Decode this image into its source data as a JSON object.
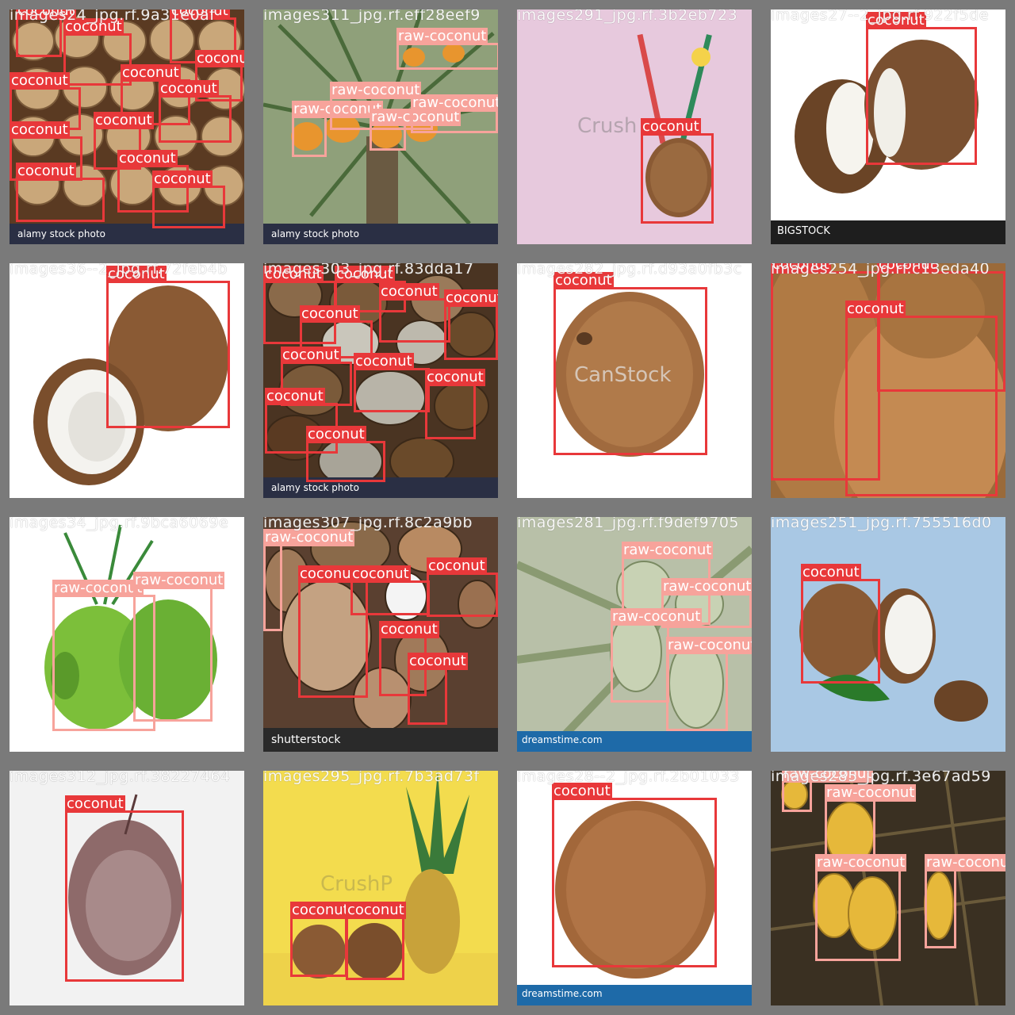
{
  "colors": {
    "coconut": "#e8383a",
    "raw_coconut": "#f7a39b",
    "background": "#7a7a7a"
  },
  "tiles": [
    {
      "title": "images24_jpg.rf.9a31e0af",
      "watermark": "alamy stock photo",
      "boxes": [
        {
          "label": "coconut",
          "cls": "coconut"
        },
        {
          "label": "coconut",
          "cls": "coconut"
        },
        {
          "label": "coconut",
          "cls": "coconut"
        },
        {
          "label": "coconut",
          "cls": "coconut"
        },
        {
          "label": "coconut",
          "cls": "coconut"
        },
        {
          "label": "coconut",
          "cls": "coconut"
        },
        {
          "label": "coconut",
          "cls": "coconut"
        },
        {
          "label": "coconut",
          "cls": "coconut"
        },
        {
          "label": "coconut",
          "cls": "coconut"
        },
        {
          "label": "coconut",
          "cls": "coconut"
        },
        {
          "label": "coconut",
          "cls": "coconut"
        },
        {
          "label": "coconut",
          "cls": "coconut"
        }
      ]
    },
    {
      "title": "images311_jpg.rf.eff28eef9",
      "watermark": "alamy stock photo",
      "boxes": [
        {
          "label": "raw-coconut",
          "cls": "raw"
        },
        {
          "label": "raw-coconut",
          "cls": "raw"
        },
        {
          "label": "raw-coconut",
          "cls": "raw"
        },
        {
          "label": "raw-coconut",
          "cls": "raw"
        },
        {
          "label": "raw-coconut",
          "cls": "raw"
        }
      ]
    },
    {
      "title": "images291_jpg.rf.3b2eb723",
      "watermark": "Crush",
      "boxes": [
        {
          "label": "coconut",
          "cls": "coconut"
        }
      ]
    },
    {
      "title": "images27--2_jpg.rf.922f5de",
      "watermark": "BIGSTOCK",
      "boxes": [
        {
          "label": "coconut",
          "cls": "coconut"
        }
      ]
    },
    {
      "title": "images36--2_jpg.rf.72feb4b",
      "watermark": "",
      "boxes": [
        {
          "label": "coconut",
          "cls": "coconut"
        }
      ]
    },
    {
      "title": "images303_jpg.rf.83dda17",
      "watermark": "alamy stock photo",
      "boxes": [
        {
          "label": "coconut",
          "cls": "coconut"
        },
        {
          "label": "coconut",
          "cls": "coconut"
        },
        {
          "label": "coconut",
          "cls": "coconut"
        },
        {
          "label": "coconut",
          "cls": "coconut"
        },
        {
          "label": "coconut",
          "cls": "coconut"
        },
        {
          "label": "coconut",
          "cls": "coconut"
        },
        {
          "label": "coconut",
          "cls": "coconut"
        },
        {
          "label": "coconut",
          "cls": "coconut"
        },
        {
          "label": "coconut",
          "cls": "coconut"
        },
        {
          "label": "coconut",
          "cls": "coconut"
        }
      ]
    },
    {
      "title": "images282_jpg.rf.d93a0fb3c",
      "watermark": "CanStock",
      "boxes": [
        {
          "label": "coconut",
          "cls": "coconut"
        }
      ]
    },
    {
      "title": "images254_jpg.rf.c13eda40",
      "watermark": "",
      "boxes": [
        {
          "label": "coconut",
          "cls": "coconut"
        },
        {
          "label": "coconut",
          "cls": "coconut"
        },
        {
          "label": "coconut",
          "cls": "coconut"
        }
      ]
    },
    {
      "title": "images34_jpg.rf.9bca6069e",
      "watermark": "",
      "boxes": [
        {
          "label": "raw-coconut",
          "cls": "raw"
        },
        {
          "label": "raw-coconut",
          "cls": "raw"
        }
      ]
    },
    {
      "title": "images307_jpg.rf.8c2a9bb",
      "watermark": "shutterstock",
      "boxes": [
        {
          "label": "raw-coconut",
          "cls": "raw"
        },
        {
          "label": "coconut",
          "cls": "coconut"
        },
        {
          "label": "coconut",
          "cls": "coconut"
        },
        {
          "label": "coconut",
          "cls": "coconut"
        },
        {
          "label": "coconut",
          "cls": "coconut"
        },
        {
          "label": "coconut",
          "cls": "coconut"
        }
      ]
    },
    {
      "title": "images281_jpg.rf.f9def9705",
      "watermark": "dreamstime.com",
      "boxes": [
        {
          "label": "raw-coconut",
          "cls": "raw"
        },
        {
          "label": "raw-coconut",
          "cls": "raw"
        },
        {
          "label": "raw-coconut",
          "cls": "raw"
        },
        {
          "label": "raw-coconut",
          "cls": "raw"
        }
      ]
    },
    {
      "title": "images251_jpg.rf.755516d0",
      "watermark": "",
      "boxes": [
        {
          "label": "coconut",
          "cls": "coconut"
        }
      ]
    },
    {
      "title": "images312_jpg.rf.38227464",
      "watermark": "",
      "boxes": [
        {
          "label": "coconut",
          "cls": "coconut"
        }
      ]
    },
    {
      "title": "images295_jpg.rf.7b3ad73f",
      "watermark": "CrushP",
      "boxes": [
        {
          "label": "coconut",
          "cls": "coconut"
        },
        {
          "label": "coconut",
          "cls": "coconut"
        }
      ]
    },
    {
      "title": "images28--2_jpg.rf.2b01033",
      "watermark": "dreamstime.com",
      "boxes": [
        {
          "label": "coconut",
          "cls": "coconut"
        }
      ]
    },
    {
      "title": "images285_jpg.rf.3e67ad59",
      "watermark": "",
      "boxes": [
        {
          "label": "raw-coconut",
          "cls": "raw"
        },
        {
          "label": "raw-coconut",
          "cls": "raw"
        },
        {
          "label": "raw-coconut",
          "cls": "raw"
        },
        {
          "label": "raw-coconut",
          "cls": "raw"
        }
      ]
    }
  ]
}
